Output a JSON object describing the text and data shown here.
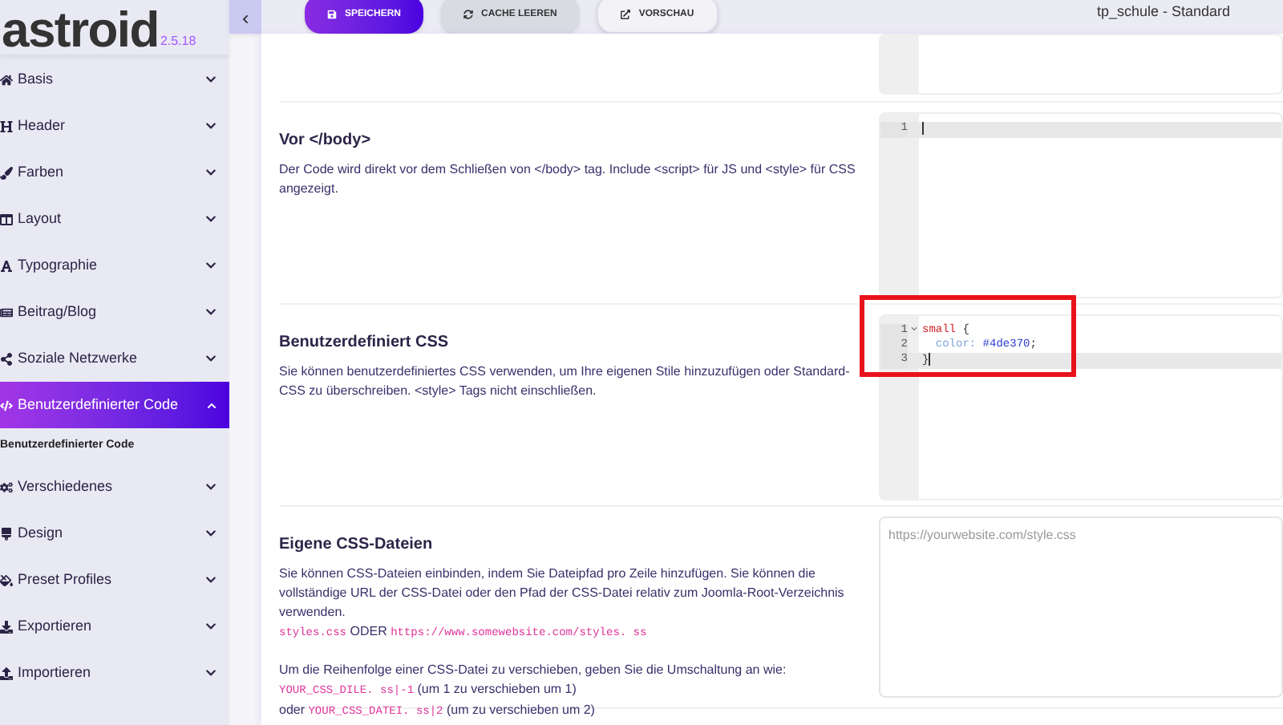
{
  "logo": {
    "name": "astroid",
    "version": "2.5.18"
  },
  "toolbar": {
    "buttons": [
      {
        "label": "SPEICHERN",
        "kind": "primary"
      },
      {
        "label": "CACHE LEEREN",
        "kind": "secondary"
      },
      {
        "label": "VORSCHAU",
        "kind": "light"
      }
    ],
    "title": "tp_schule - Standard"
  },
  "sidebar": {
    "items": [
      {
        "label": "Basis",
        "expanded": false,
        "selected": false
      },
      {
        "label": "Header",
        "expanded": false,
        "selected": false
      },
      {
        "label": "Farben",
        "expanded": false,
        "selected": false
      },
      {
        "label": "Layout",
        "expanded": false,
        "selected": false
      },
      {
        "label": "Typographie",
        "expanded": false,
        "selected": false
      },
      {
        "label": "Beitrag/Blog",
        "expanded": false,
        "selected": false
      },
      {
        "label": "Soziale Netzwerke",
        "expanded": false,
        "selected": false
      },
      {
        "label": "Benutzerdefinierter Code",
        "expanded": true,
        "selected": true,
        "children": [
          {
            "label": "Benutzerdefinierter Code"
          }
        ]
      },
      {
        "label": "Verschiedenes",
        "expanded": false,
        "selected": false
      },
      {
        "label": "Design",
        "expanded": false,
        "selected": false
      },
      {
        "label": "Preset Profiles",
        "expanded": false,
        "selected": false
      },
      {
        "label": "Exportieren",
        "expanded": false,
        "selected": false
      },
      {
        "label": "Importieren",
        "expanded": false,
        "selected": false
      }
    ]
  },
  "sections": [
    {
      "kind": "editor"
    },
    {
      "kind": "editor",
      "title": "Vor </body>",
      "paragraphs": [
        [
          [
            {
              "text": "Der Code wird direkt vor dem Schließen von </body> tag. Include <script> für JS und <style> für CSS angezeigt.",
              "kind": "text"
            }
          ]
        ]
      ],
      "lines": [
        {
          "number": "1",
          "active": true,
          "fold": false
        }
      ]
    },
    {
      "kind": "editor",
      "title": "Benutzerdefiniert CSS",
      "highlighted": true,
      "paragraphs": [
        [
          [
            {
              "text": "Sie können benutzerdefiniertes CSS verwenden, um Ihre eigenen Stile hinzuzufügen oder Standard-CSS zu überschreiben. <style> Tags nicht einschließen.",
              "kind": "text"
            }
          ]
        ]
      ],
      "lines": [
        {
          "number": "1",
          "active": false,
          "fold": true,
          "tokens": [
            {
              "text": "small",
              "kind": "selector"
            },
            {
              "text": " {",
              "kind": "plain"
            }
          ]
        },
        {
          "number": "2",
          "active": false,
          "fold": false,
          "tokens": [
            {
              "text": "  color:",
              "kind": "property"
            },
            {
              "text": " #4de370",
              "kind": "value"
            },
            {
              "text": ";",
              "kind": "plain"
            }
          ]
        },
        {
          "number": "3",
          "active": true,
          "fold": false,
          "tokens": [
            {
              "text": "}",
              "kind": "plain"
            }
          ]
        }
      ]
    },
    {
      "kind": "textarea",
      "title": "Eigene CSS-Dateien",
      "placeholder": "https://yourwebsite.com/style.css",
      "paragraphs": [
        [
          [
            {
              "text": "Sie können CSS-Dateien einbinden, indem Sie Dateipfad pro Zeile hinzufügen. Sie können die vollständige URL der CSS-Datei oder den Pfad der CSS-Datei relativ zum Joomla-Root-Verzeichnis verwenden.",
              "kind": "text"
            }
          ],
          [
            {
              "text": "styles.css",
              "kind": "code"
            },
            {
              "text": " ODER ",
              "kind": "text"
            },
            {
              "text": "https://www.somewebsite.com/styles. ss",
              "kind": "code"
            }
          ]
        ],
        [
          [
            {
              "text": "Um die Reihenfolge einer CSS-Datei zu verschieben, geben Sie die Umschaltung an wie:",
              "kind": "text"
            }
          ],
          [
            {
              "text": "YOUR_CSS_DILE. ss|-1",
              "kind": "code"
            },
            {
              "text": " (um 1 zu verschieben um 1)",
              "kind": "text"
            }
          ],
          [
            {
              "text": "oder ",
              "kind": "text"
            },
            {
              "text": "YOUR_CSS_DATEI. ss|2",
              "kind": "code"
            },
            {
              "text": " (um zu verschieben um 2)",
              "kind": "text"
            }
          ]
        ]
      ]
    }
  ]
}
